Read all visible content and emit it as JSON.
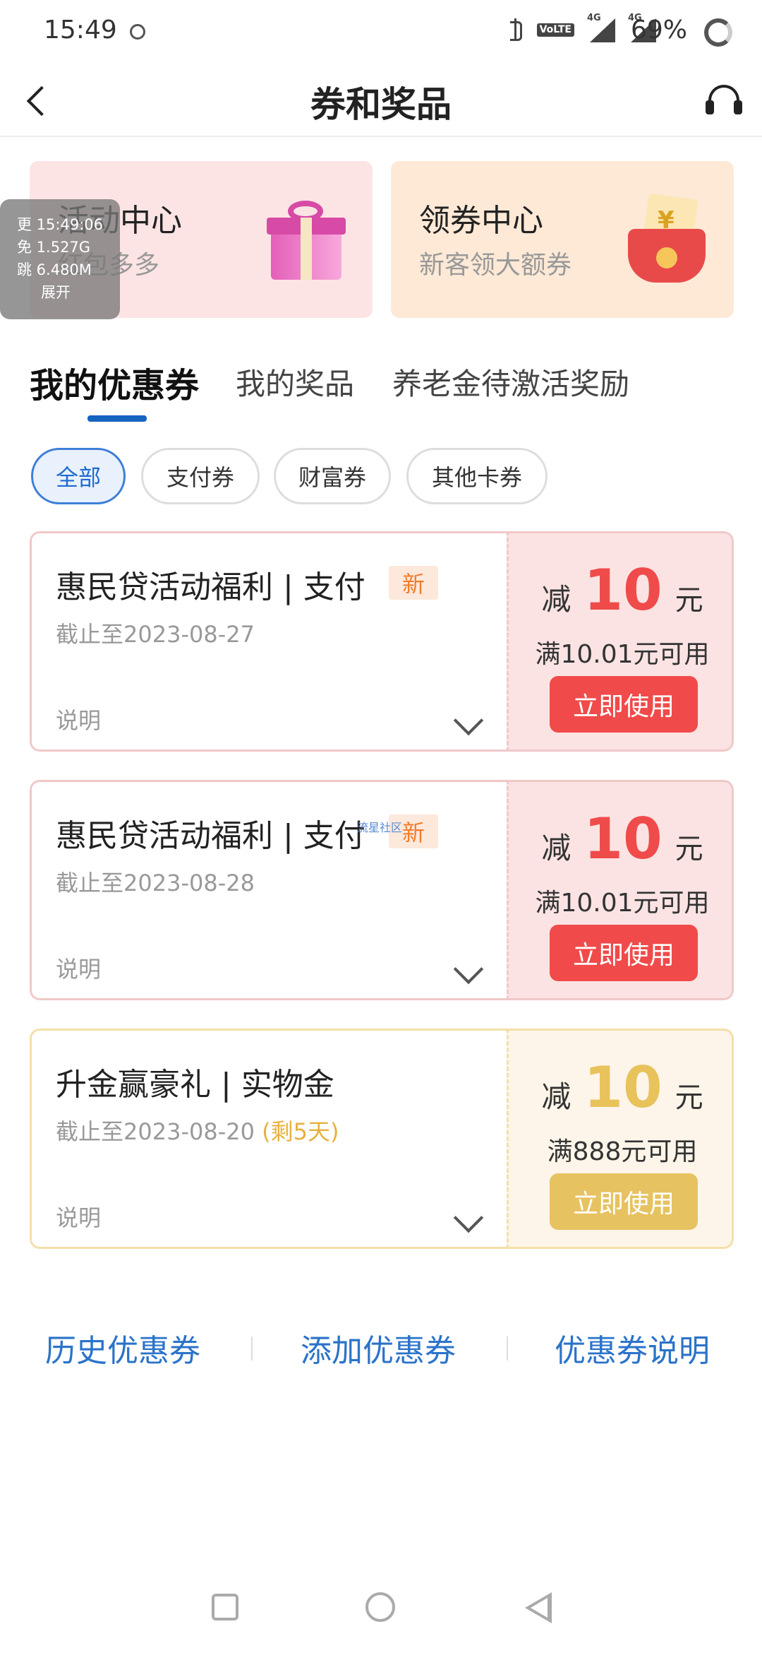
{
  "status_bar": {
    "time": "15:49",
    "volte": "VoLTE",
    "net1": "4G",
    "net2": "4G",
    "battery": "69%"
  },
  "header": {
    "title": "券和奖品"
  },
  "promos": [
    {
      "title": "活动中心",
      "subtitle": "红包多多",
      "icon": "gift-icon"
    },
    {
      "title": "领券中心",
      "subtitle": "新客领大额券",
      "icon": "red-envelope-icon"
    }
  ],
  "overlay": {
    "line1": "更 15:49:06",
    "line2": "免 1.527G",
    "line3": "跳 6.480M",
    "expand": "展开"
  },
  "tabs": [
    {
      "label": "我的优惠券",
      "active": true
    },
    {
      "label": "我的奖品",
      "active": false
    },
    {
      "label": "养老金待激活奖励",
      "active": false
    }
  ],
  "filters": [
    {
      "label": "全部",
      "active": true
    },
    {
      "label": "支付券",
      "active": false
    },
    {
      "label": "财富券",
      "active": false
    },
    {
      "label": "其他卡券",
      "active": false
    }
  ],
  "coupons": [
    {
      "title": "惠民贷活动福利 | 支付",
      "tag": "新",
      "date": "截止至2023-08-27",
      "remain": "",
      "note": "说明",
      "prefix": "减",
      "amount": "10",
      "unit": "元",
      "condition": "满10.01元可用",
      "button": "立即使用"
    },
    {
      "title": "惠民贷活动福利 | 支付",
      "tag": "新",
      "date": "截止至2023-08-28",
      "remain": "",
      "note": "说明",
      "prefix": "减",
      "amount": "10",
      "unit": "元",
      "condition": "满10.01元可用",
      "button": "立即使用"
    },
    {
      "title": "升金赢豪礼 | 实物金",
      "tag": "",
      "date": "截止至2023-08-20",
      "remain": "(剩5天)",
      "note": "说明",
      "prefix": "减",
      "amount": "10",
      "unit": "元",
      "condition": "满888元可用",
      "button": "立即使用"
    }
  ],
  "watermark": "流星社区",
  "bottom_links": {
    "history": "历史优惠券",
    "add": "添加优惠券",
    "explain": "优惠券说明"
  },
  "colors": {
    "accent_blue": "#1565c0",
    "coupon_red": "#ef4b4b",
    "coupon_gold": "#e8c25a",
    "link_blue": "#2b73c9"
  }
}
